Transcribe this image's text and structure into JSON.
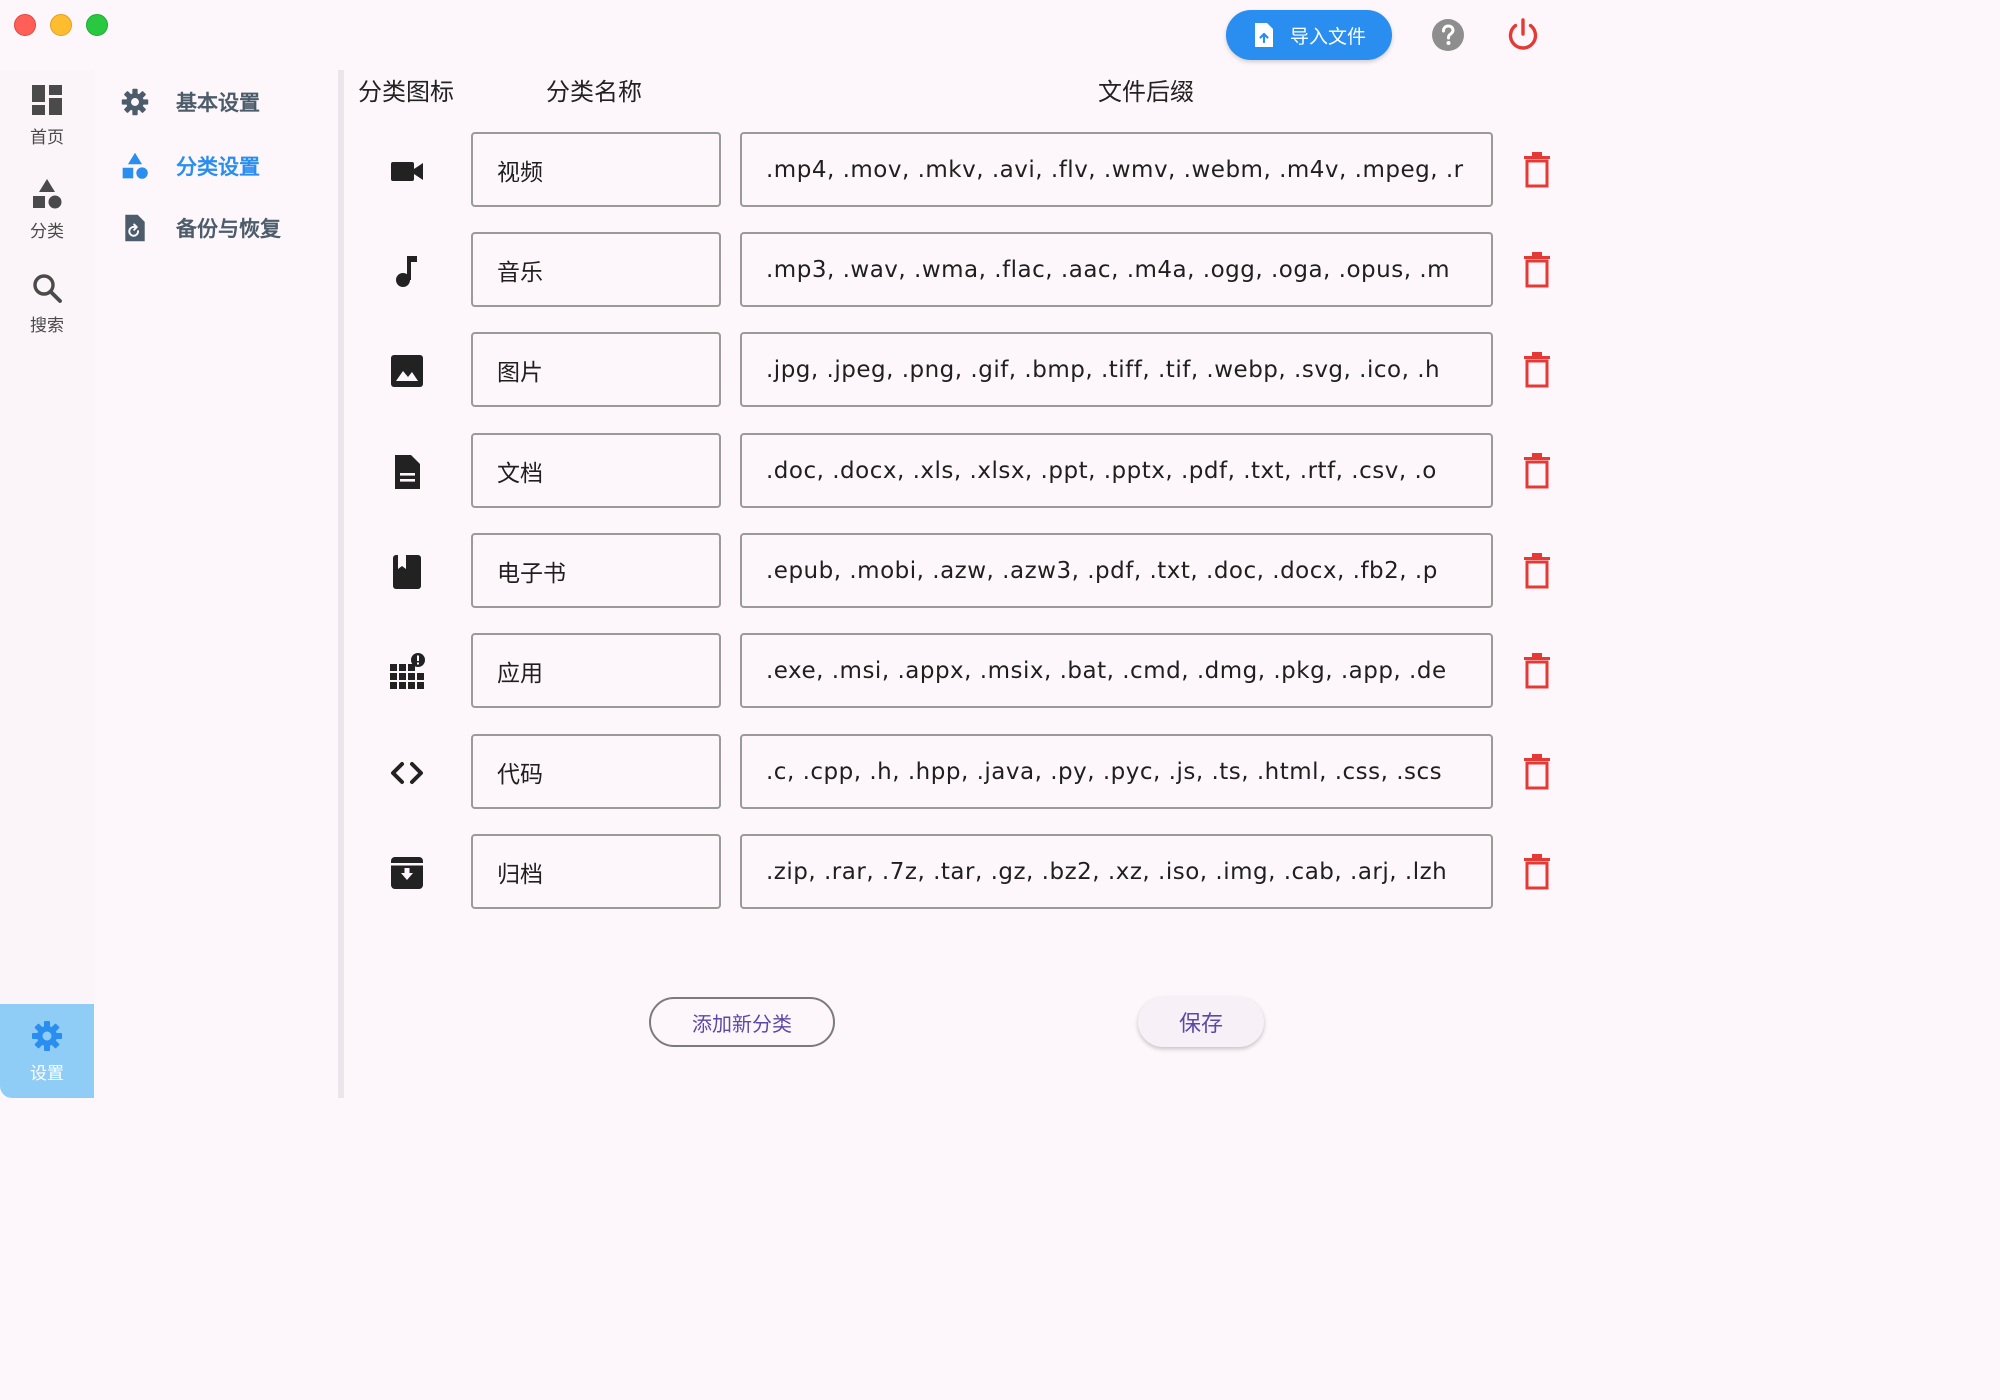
{
  "titlebar": {
    "import_label": "导入文件"
  },
  "rail": {
    "home": "首页",
    "category": "分类",
    "search": "搜索",
    "settings": "设置"
  },
  "menu": {
    "basic": "基本设置",
    "category": "分类设置",
    "backup": "备份与恢复"
  },
  "table": {
    "headers": {
      "icon": "分类图标",
      "name": "分类名称",
      "ext": "文件后缀"
    },
    "rows": [
      {
        "icon": "videocam-icon",
        "name": "视频",
        "ext": ".mp4, .mov, .mkv, .avi, .flv, .wmv, .webm, .m4v, .mpeg, .r"
      },
      {
        "icon": "music-note-icon",
        "name": "音乐",
        "ext": ".mp3, .wav, .wma, .flac, .aac, .m4a, .ogg, .oga, .opus, .m"
      },
      {
        "icon": "image-icon",
        "name": "图片",
        "ext": ".jpg, .jpeg, .png, .gif, .bmp, .tiff, .tif, .webp, .svg, .ico, .h"
      },
      {
        "icon": "document-icon",
        "name": "文档",
        "ext": ".doc, .docx, .xls, .xlsx, .ppt, .pptx, .pdf, .txt, .rtf, .csv, .o"
      },
      {
        "icon": "book-icon",
        "name": "电子书",
        "ext": ".epub, .mobi, .azw, .azw3, .pdf, .txt, .doc, .docx, .fb2, .p"
      },
      {
        "icon": "apps-icon",
        "name": "应用",
        "ext": ".exe, .msi, .appx, .msix, .bat, .cmd, .dmg, .pkg, .app, .de"
      },
      {
        "icon": "code-icon",
        "name": "代码",
        "ext": ".c, .cpp, .h, .hpp, .java, .py, .pyc, .js, .ts, .html, .css, .scs"
      },
      {
        "icon": "archive-icon",
        "name": "归档",
        "ext": ".zip, .rar, .7z, .tar, .gz, .bz2, .xz, .iso, .img, .cab, .arj, .lzh"
      }
    ]
  },
  "actions": {
    "add_label": "添加新分类",
    "save_label": "保存"
  },
  "colors": {
    "accent": "#2a8df0",
    "delete": "#e53935",
    "button_text": "#5a4aa8"
  }
}
